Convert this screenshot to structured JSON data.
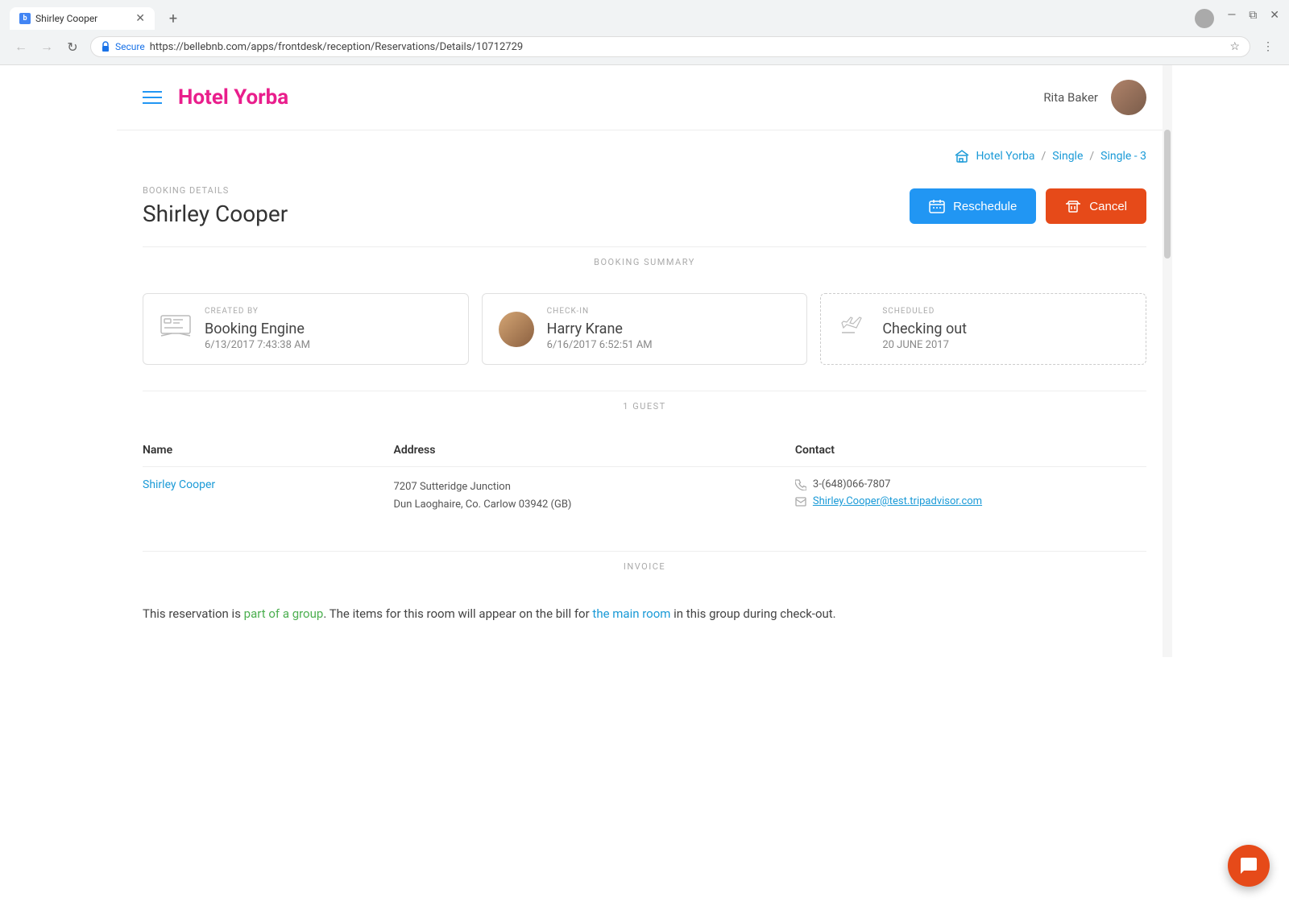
{
  "browser": {
    "tab_title": "Shirley Cooper",
    "tab_favicon": "b",
    "url_secure": "Secure",
    "url": "https://bellebnb.com/apps/frontdesk/reception/Reservations/Details/10712729",
    "new_tab_symbol": "+",
    "minimize": "—",
    "restore": "⧉",
    "close": "✕",
    "back": "←",
    "forward": "→",
    "refresh": "↻",
    "star": "☆",
    "menu": "⋮"
  },
  "header": {
    "brand": "Hotel Yorba",
    "username": "Rita Baker"
  },
  "breadcrumb": {
    "items": [
      "Hotel Yorba",
      "Single",
      "Single - 3"
    ],
    "separator": "/"
  },
  "booking": {
    "label": "BOOKING DETAILS",
    "name": "Shirley Cooper",
    "reschedule_label": "Reschedule",
    "cancel_label": "Cancel"
  },
  "summary": {
    "section_label": "BOOKING SUMMARY",
    "cards": [
      {
        "meta": "CREATED BY",
        "title": "Booking Engine",
        "subtitle": "6/13/2017 7:43:38 AM",
        "icon_type": "engine"
      },
      {
        "meta": "CHECK-IN",
        "title": "Harry Krane",
        "subtitle": "6/16/2017 6:52:51 AM",
        "icon_type": "avatar"
      },
      {
        "meta": "SCHEDULED",
        "title": "Checking out",
        "subtitle": "20 JUNE 2017",
        "icon_type": "plane"
      }
    ]
  },
  "guests": {
    "section_label": "1 GUEST",
    "columns": [
      "Name",
      "Address",
      "Contact"
    ],
    "rows": [
      {
        "name": "Shirley Cooper",
        "address_line1": "7207 Sutteridge Junction",
        "address_line2": "Dun Laoghaire, Co. Carlow 03942 (GB)",
        "phone": "3-(648)066-7807",
        "email": "Shirley.Cooper@test.tripadvisor.com"
      }
    ]
  },
  "invoice": {
    "section_label": "INVOICE",
    "text_before_link1": "This reservation is ",
    "link1_text": "part of a group",
    "text_between": ". The items for this room will appear on the bill for ",
    "link2_text": "the main room",
    "text_after": " in this group during check-out."
  }
}
